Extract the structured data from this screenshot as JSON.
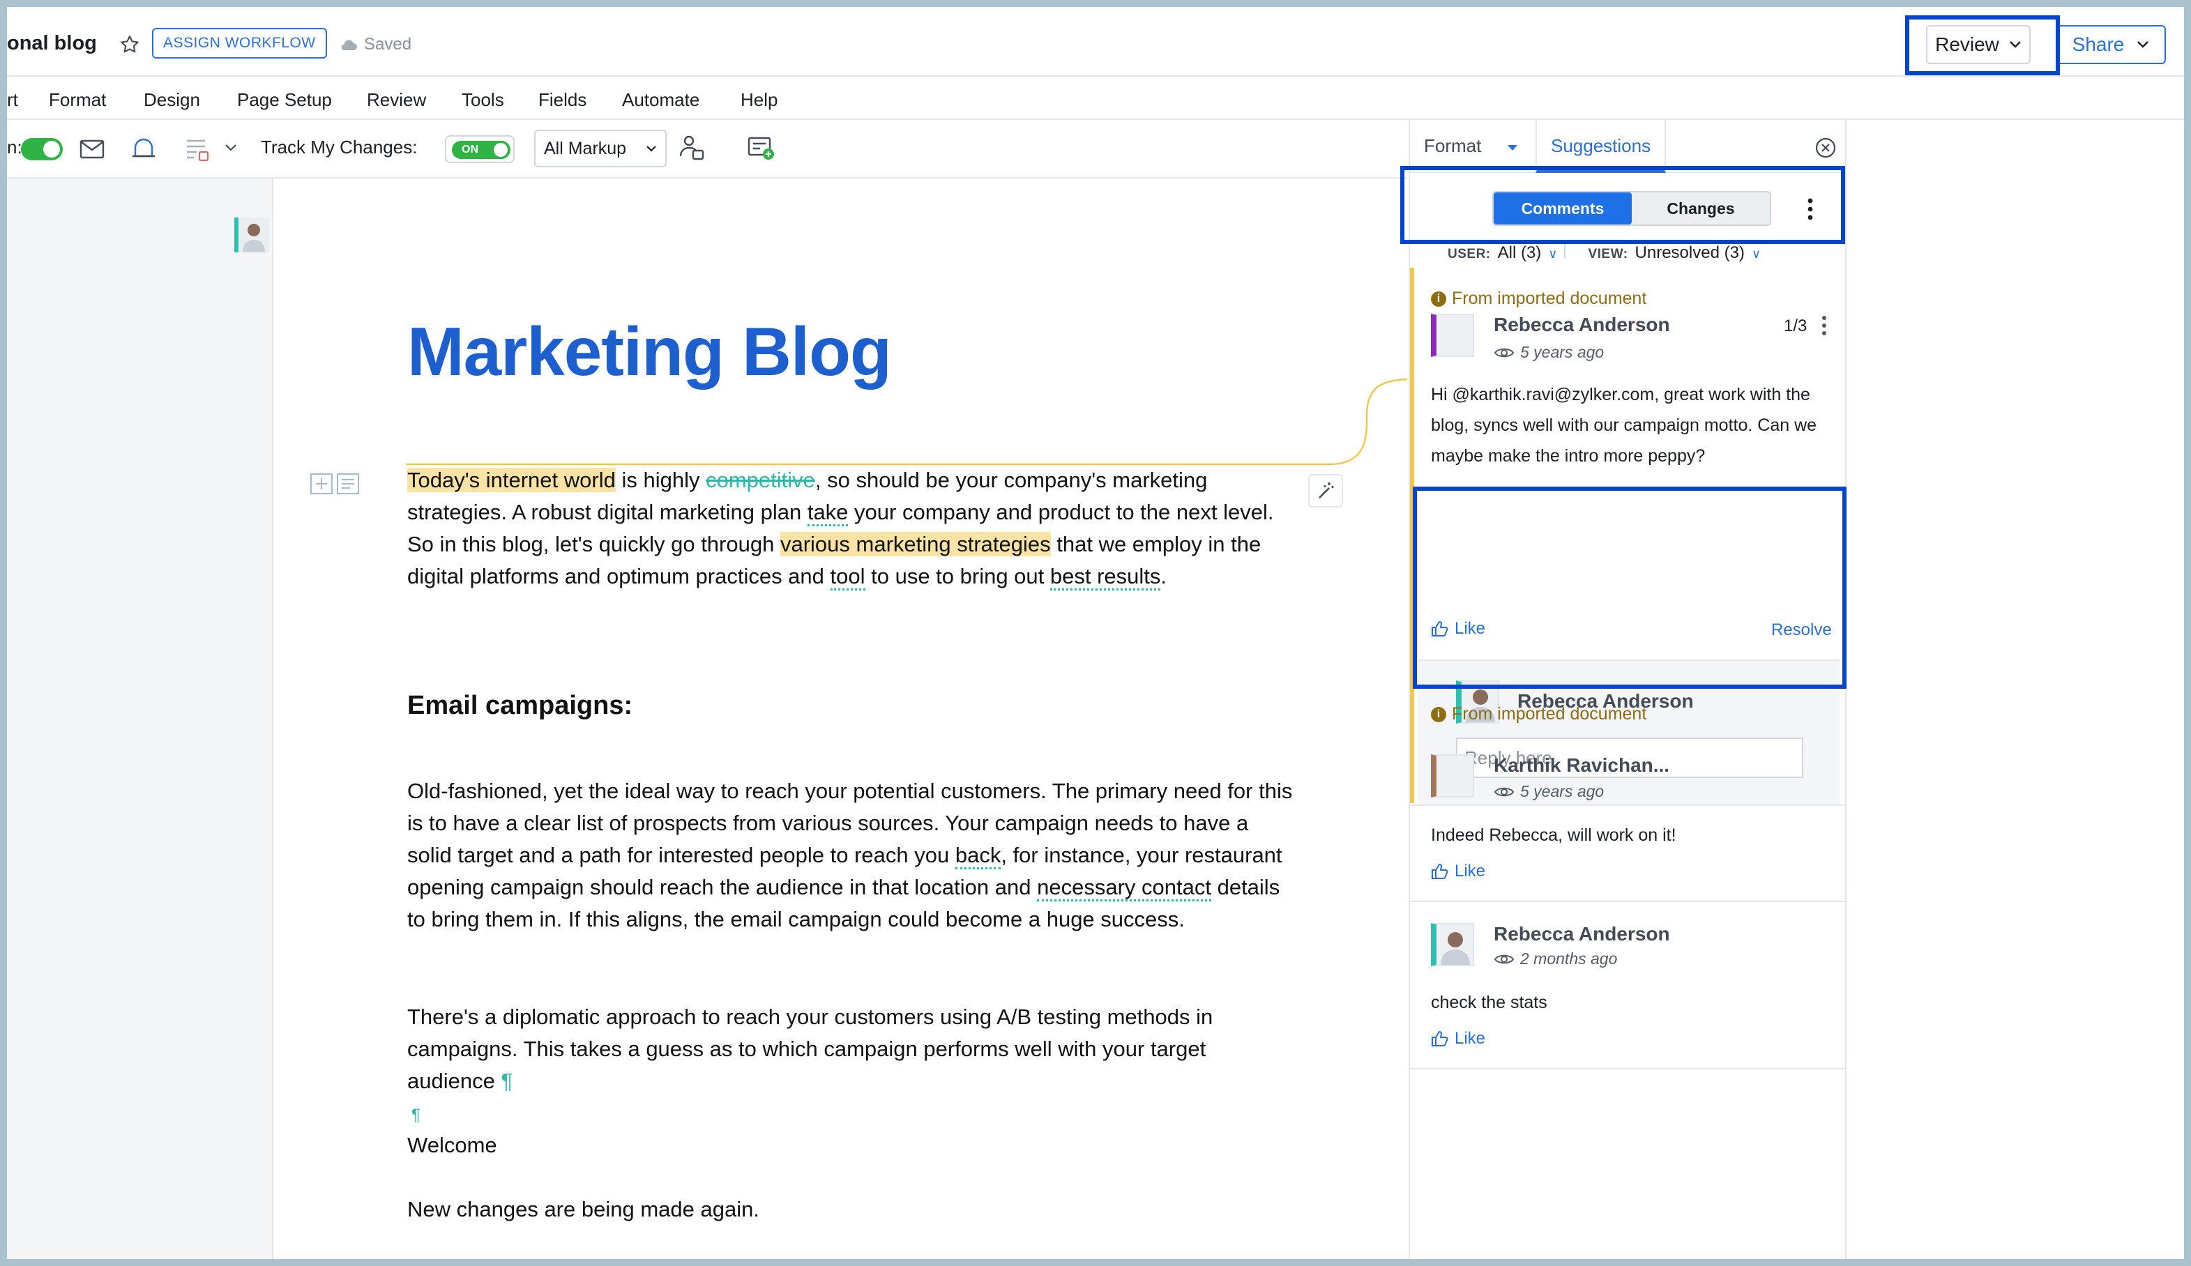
{
  "header": {
    "doc_title": "onal blog",
    "assign_workflow": "ASSIGN WORKFLOW",
    "saved": "Saved",
    "review": "Review",
    "share": "Share"
  },
  "menu": [
    "rt",
    "Format",
    "Design",
    "Page Setup",
    "Review",
    "Tools",
    "Fields",
    "Automate",
    "Help"
  ],
  "toolbar": {
    "cut_label": "n:",
    "track_label": "Track My Changes:",
    "track_state": "ON",
    "markup": "All Markup"
  },
  "document": {
    "title": "Marketing Blog",
    "p1": {
      "hl1": "Today's internet world",
      "t1": " is highly ",
      "strike": "competitive",
      "t2": ", so should be your company's marketing strategies. A robust digital marketing plan ",
      "d1": "take",
      "t3": " your company and product to the next level. So in this blog, let's quickly go through ",
      "hl2": "various marketing strategies",
      "t4": " that we employ in the digital platforms and optimum practices and ",
      "d2": "tool",
      "t5": " to use to bring out ",
      "d3": "best results",
      "t6": "."
    },
    "heading": "Email campaigns:",
    "p2": {
      "t1": "Old-fashioned, yet the ideal way to reach your potential customers. The primary need for this is to have a clear list of prospects from various sources. Your campaign needs to have a solid target and a path for interested people to reach you ",
      "d1": "back",
      "t2": ", for instance, your restaurant opening campaign should reach the audience in that location and ",
      "d2": "necessary contact",
      "t3": " details to bring them in. If this aligns, the email campaign could become a huge success."
    },
    "p3": "There's a diplomatic approach to reach your customers using A/B testing methods in campaigns. This takes a guess as to which campaign performs well with your target audience",
    "pilcrow": "¶",
    "p4": "Welcome",
    "p5": "New changes are being made again."
  },
  "panel": {
    "tab_format": "Format",
    "tab_suggestions": "Suggestions",
    "seg_comments": "Comments",
    "seg_changes": "Changes",
    "user_label": "USER:",
    "user_value": "All (3)",
    "view_label": "VIEW:",
    "view_value": "Unresolved (3)",
    "imported_note": "From imported document",
    "c1": {
      "name": "Rebecca Anderson",
      "time": "5 years ago",
      "count": "1/3",
      "text": "Hi @karthik.ravi@zylker.com, great work with the blog, syncs well with our campaign motto. Can we maybe make the intro more peppy?",
      "like": "Like",
      "resolve": "Resolve"
    },
    "reply": {
      "name": "Rebecca Anderson",
      "placeholder": "Reply here"
    },
    "c2": {
      "note": "From imported document",
      "name": "Karthik Ravichan...",
      "time": "5 years ago",
      "text": "Indeed Rebecca, will work on it!",
      "like": "Like"
    },
    "c3": {
      "name": "Rebecca Anderson",
      "time": "2 months ago",
      "text": "check the stats",
      "like": "Like"
    }
  },
  "colors": {
    "accent": "#2b6fd6",
    "title_blue": "#1d5fcf",
    "highlight": "#fbe3a6",
    "track_green": "#2fb344",
    "callout_box": "#0645c9"
  }
}
